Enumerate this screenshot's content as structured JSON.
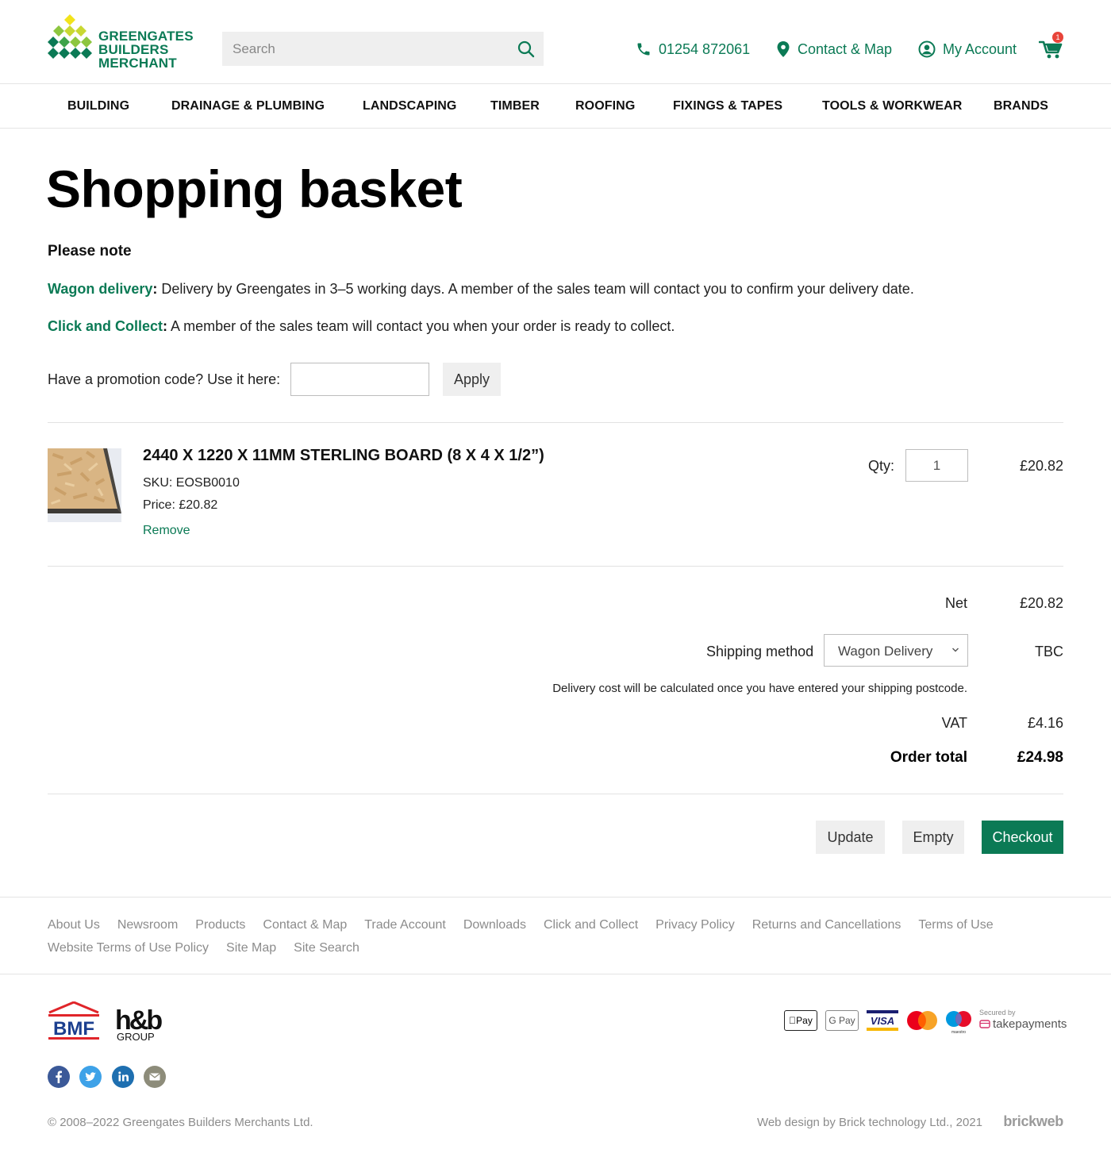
{
  "header": {
    "logo_lines": [
      "GREENGATES",
      "BUILDERS",
      "MERCHANT"
    ],
    "search_placeholder": "Search",
    "phone": "01254 872061",
    "contact_label": "Contact & Map",
    "account_label": "My Account",
    "cart_count": "1"
  },
  "nav": [
    "BUILDING",
    "DRAINAGE & PLUMBING",
    "LANDSCAPING",
    "TIMBER",
    "ROOFING",
    "FIXINGS & TAPES",
    "TOOLS & WORKWEAR",
    "BRANDS"
  ],
  "page": {
    "title": "Shopping basket",
    "note_heading": "Please note",
    "wagon_label": "Wagon delivery",
    "wagon_text": " Delivery by Greengates in 3–5 working days. A member of the sales team will contact you to confirm your delivery date.",
    "collect_label": "Click and Collect",
    "collect_text": " A member of the sales team will contact you when your order is ready to collect.",
    "colon": ":",
    "promo_label": "Have a promotion code? Use it here:",
    "promo_value": "",
    "apply_label": "Apply"
  },
  "item": {
    "name": "2440 X 1220 X 11MM STERLING BOARD (8 X 4 X 1/2”)",
    "sku": "SKU: EOSB0010",
    "price": "Price: £20.82",
    "remove_label": "Remove",
    "qty_label": "Qty:",
    "qty": "1",
    "line_total": "£20.82"
  },
  "summary": {
    "net_label": "Net",
    "net_value": "£20.82",
    "shipping_label": "Shipping method",
    "shipping_selected": "Wagon Delivery",
    "shipping_value": "TBC",
    "delivery_note": "Delivery cost will be calculated once you have entered your shipping postcode.",
    "vat_label": "VAT",
    "vat_value": "£4.16",
    "total_label": "Order total",
    "total_value": "£24.98"
  },
  "actions": {
    "update_label": "Update",
    "empty_label": "Empty",
    "checkout_label": "Checkout"
  },
  "footer": {
    "links": [
      "About Us",
      "Newsroom",
      "Products",
      "Contact & Map",
      "Trade Account",
      "Downloads",
      "Click and Collect",
      "Privacy Policy",
      "Returns and Cancellations",
      "Terms of Use",
      "Website Terms of Use Policy",
      "Site Map",
      "Site Search"
    ],
    "bmf_text": "BMF",
    "hb_text": "h&b",
    "hb_group": "GROUP",
    "applepay": "Pay",
    "gpay": "G Pay",
    "visa": "VISA",
    "maestro": "maestro",
    "take_secured": "Secured by",
    "take_brand": "takepayments",
    "copyright": "© 2008–2022  Greengates Builders Merchants Ltd.",
    "credit": "Web design by Brick technology Ltd., 2021",
    "brickweb": "brickweb"
  },
  "colors": {
    "brand_green": "#0b7a55",
    "logo_yellow": "#f2e31b",
    "logo_lime": "#8dc63f",
    "badge_red": "#e8443a"
  }
}
